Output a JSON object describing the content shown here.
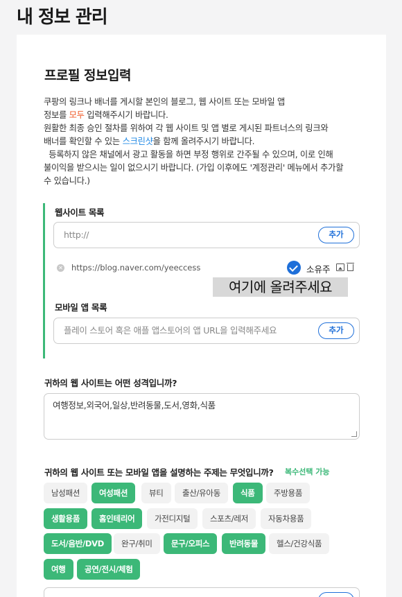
{
  "page": {
    "title": "내 정보 관리"
  },
  "profile": {
    "section_title": "프로필 정보입력",
    "intro": {
      "line1": "쿠팡의 링크나 배너를 게시할 본인의 블로그, 웹 사이트 또는 모바일 앱",
      "line2_a": "정보를 ",
      "line2_highlight": "모두",
      "line2_b": " 입력해주시기 바랍니다.",
      "line3": "원활한 최종 승인 절차를 위하여 각 웹 사이트 및 앱 별로 게시된 파트너스의 링크와",
      "line4_a": "배너를 확인할 수 있는 ",
      "line4_highlight": "스크린샷",
      "line4_b": "을 함께 올려주시기 바랍니다.",
      "line5": "  등록하지 않은 채널에서 광고 활동을 하면 부정 행위로 간주될 수 있으며, 이로 인해",
      "line6": "불이익을 받으시는 일이 없으시기 바랍니다. (가입 이후에도 '계정관리' 메뉴에서 추가할",
      "line7": "수 있습니다.)"
    }
  },
  "website": {
    "label": "웹사이트 목록",
    "placeholder": "http://",
    "add_label": "추가",
    "items": [
      {
        "url": "https://blog.naver.com/yeeccess",
        "owner": "소유주"
      }
    ],
    "upload_note": "여기에 올려주세요"
  },
  "mobile_app": {
    "label": "모바일 앱 목록",
    "placeholder": "플레이 스토어 혹은 애플 앱스토어의 앱 URL을 입력해주세요",
    "add_label": "추가"
  },
  "site_nature": {
    "question": "귀하의 웹 사이트는 어떤 성격입니까?",
    "value": "여행정보,외국어,일상,반려동물,도서,영화,식품"
  },
  "topics": {
    "question": "귀하의 웹 사이트 또는 모바일 앱을 설명하는 주제는 무엇입니까?",
    "multi_note": "복수선택 가능",
    "options": [
      {
        "label": "남성패션",
        "selected": false
      },
      {
        "label": "여성패션",
        "selected": true
      },
      {
        "label": "뷰티",
        "selected": false
      },
      {
        "label": "출산/유아동",
        "selected": false
      },
      {
        "label": "식품",
        "selected": true
      },
      {
        "label": "주방용품",
        "selected": false
      },
      {
        "label": "생활용품",
        "selected": true
      },
      {
        "label": "홈인테리어",
        "selected": true
      },
      {
        "label": "가전디지털",
        "selected": false
      },
      {
        "label": "스포츠/레저",
        "selected": false
      },
      {
        "label": "자동차용품",
        "selected": false
      },
      {
        "label": "도서/음반/DVD",
        "selected": true
      },
      {
        "label": "완구/취미",
        "selected": false
      },
      {
        "label": "문구/오피스",
        "selected": true
      },
      {
        "label": "반려동물",
        "selected": true
      },
      {
        "label": "헬스/건강식품",
        "selected": false
      },
      {
        "label": "여행",
        "selected": true
      },
      {
        "label": "공연/전시/체험",
        "selected": true
      }
    ]
  },
  "colors": {
    "accent_green": "#3cb878",
    "accent_blue": "#1e6fd9",
    "highlight_orange": "#f05a28"
  }
}
